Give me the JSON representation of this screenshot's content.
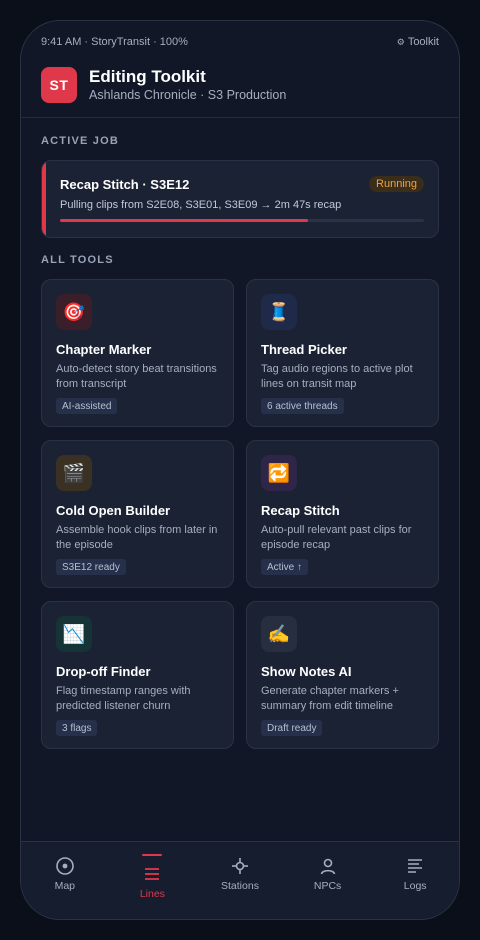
{
  "status_bar": {
    "left": "9:41 AM · StoryTransit · 100%",
    "right_icon": "gear-icon",
    "right_label": "Toolkit"
  },
  "header": {
    "logo_text": "ST",
    "title": "Editing Toolkit",
    "subtitle": "Ashlands Chronicle · S3 Production",
    "accent_color": "#e0384b"
  },
  "active_job": {
    "section_label": "ACTIVE JOB",
    "title": "Recap Stitch · S3E12",
    "status": "Running",
    "description": "Pulling clips from S2E08, S3E01, S3E09 → 2m 47s recap",
    "progress_fraction": 0.68
  },
  "tools": {
    "section_label": "ALL TOOLS",
    "items": [
      {
        "icon": "dart-target-icon",
        "glyph": "🎯",
        "title": "Chapter Marker",
        "description": "Auto-detect story beat transitions from transcript",
        "tag": "AI-assisted",
        "icon_bg": "#3a1f2a"
      },
      {
        "icon": "thread-spool-icon",
        "glyph": "🧵",
        "title": "Thread Picker",
        "description": "Tag audio regions to active plot lines on transit map",
        "tag": "6 active threads",
        "icon_bg": "#1f2a4a"
      },
      {
        "icon": "clapper-board-icon",
        "glyph": "🎬",
        "title": "Cold Open Builder",
        "description": "Assemble hook clips from later in the episode",
        "tag": "S3E12 ready",
        "icon_bg": "#3a3122"
      },
      {
        "icon": "repeat-icon",
        "glyph": "🔁",
        "title": "Recap Stitch",
        "description": "Auto-pull relevant past clips for episode recap",
        "tag": "Active ↑",
        "icon_bg": "#2e2548"
      },
      {
        "icon": "chart-decreasing-icon",
        "glyph": "📉",
        "title": "Drop-off Finder",
        "description": "Flag timestamp ranges with predicted listener churn",
        "tag": "3 flags",
        "icon_bg": "#163336"
      },
      {
        "icon": "writing-hand-icon",
        "glyph": "✍️",
        "title": "Show Notes AI",
        "description": "Generate chapter markers + summary from edit timeline",
        "tag": "Draft ready",
        "icon_bg": "#262e40"
      }
    ]
  },
  "tabs": [
    {
      "label": "Map",
      "icon": "map-pin-circle-icon",
      "active": false
    },
    {
      "label": "Lines",
      "icon": "lines-menu-icon",
      "active": true
    },
    {
      "label": "Stations",
      "icon": "station-crosshair-icon",
      "active": false
    },
    {
      "label": "NPCs",
      "icon": "person-icon",
      "active": false
    },
    {
      "label": "Logs",
      "icon": "log-list-icon",
      "active": false
    }
  ]
}
